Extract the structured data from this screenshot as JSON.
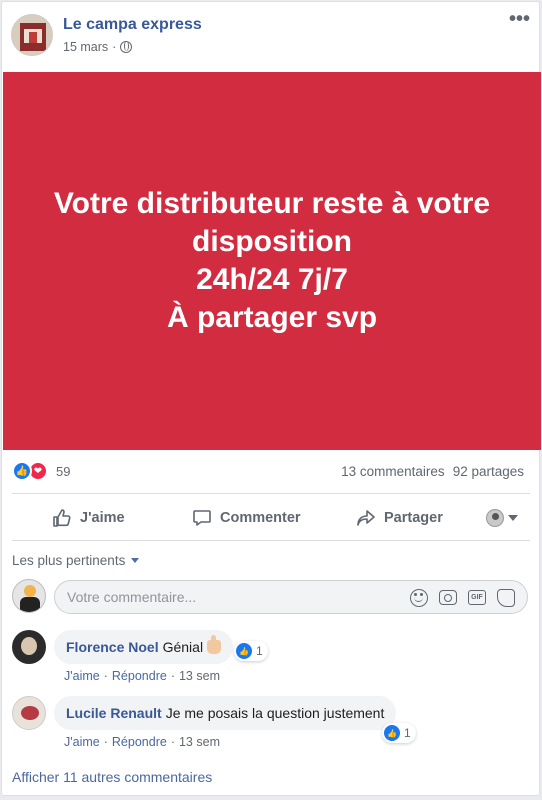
{
  "post": {
    "page_name": "Le campa express",
    "date": "15 mars",
    "separator": "·",
    "privacy_icon": "globe-icon",
    "more_icon": "more-options-icon",
    "more_glyph": "•••"
  },
  "image": {
    "background_color": "#d12c40",
    "lines": [
      "Votre distributeur reste à votre",
      "disposition",
      "24h/24 7j/7",
      "À partager svp"
    ]
  },
  "reactions": {
    "icons": [
      "like-reaction-icon",
      "love-reaction-icon"
    ],
    "count": "59",
    "comments": "13 commentaires",
    "shares": "92 partages"
  },
  "actions": {
    "like": "J'aime",
    "comment": "Commenter",
    "share": "Partager"
  },
  "comments": {
    "sort_label": "Les plus pertinents",
    "input_placeholder": "Votre commentaire...",
    "input_icons": [
      "emoji-icon",
      "camera-icon",
      "gif-icon",
      "sticker-icon"
    ],
    "gif_label": "GIF",
    "items": [
      {
        "author": "Florence Noel",
        "text": "Génial",
        "reaction_count": "1",
        "like": "J'aime",
        "reply": "Répondre",
        "time": "13 sem"
      },
      {
        "author": "Lucile Renault",
        "text": "Je me posais la question justement",
        "reaction_count": "1",
        "like": "J'aime",
        "reply": "Répondre",
        "time": "13 sem"
      }
    ],
    "more_link": "Afficher 11 autres commentaires"
  },
  "colors": {
    "link_blue": "#385898",
    "like_blue": "#1877f2",
    "love_red": "#f0284a",
    "secondary_text": "#606770"
  }
}
